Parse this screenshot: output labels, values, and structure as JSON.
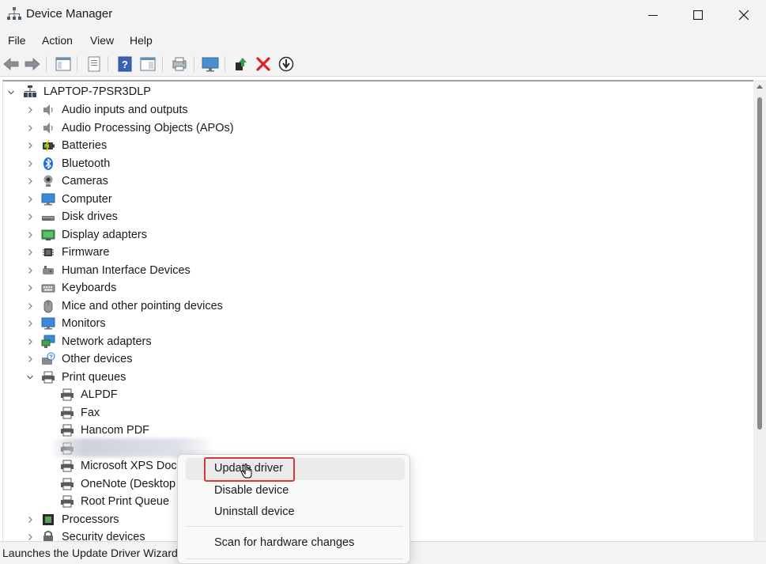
{
  "window": {
    "title": "Device Manager",
    "icon": "device-manager-icon"
  },
  "menu": [
    "File",
    "Action",
    "View",
    "Help"
  ],
  "toolbar": [
    "back-arrow-icon",
    "forward-arrow-icon",
    "show-hide-console-tree-icon",
    "properties-icon",
    "help-icon",
    "action-pane-icon",
    "scan-hardware-icon",
    "monitor-icon",
    "update-driver-icon",
    "uninstall-device-icon",
    "download-icon"
  ],
  "tree": {
    "root": "LAPTOP-7PSR3DLP",
    "categories": [
      {
        "label": "Audio inputs and outputs",
        "icon": "speaker-icon"
      },
      {
        "label": "Audio Processing Objects (APOs)",
        "icon": "speaker-icon"
      },
      {
        "label": "Batteries",
        "icon": "battery-icon"
      },
      {
        "label": "Bluetooth",
        "icon": "bluetooth-icon"
      },
      {
        "label": "Cameras",
        "icon": "camera-icon"
      },
      {
        "label": "Computer",
        "icon": "computer-icon"
      },
      {
        "label": "Disk drives",
        "icon": "disk-drive-icon"
      },
      {
        "label": "Display adapters",
        "icon": "display-adapter-icon"
      },
      {
        "label": "Firmware",
        "icon": "firmware-chip-icon"
      },
      {
        "label": "Human Interface Devices",
        "icon": "hid-icon"
      },
      {
        "label": "Keyboards",
        "icon": "keyboard-icon"
      },
      {
        "label": "Mice and other pointing devices",
        "icon": "mouse-icon"
      },
      {
        "label": "Monitors",
        "icon": "monitor-icon"
      },
      {
        "label": "Network adapters",
        "icon": "network-adapter-icon"
      },
      {
        "label": "Other devices",
        "icon": "unknown-device-icon"
      },
      {
        "label": "Print queues",
        "icon": "printer-icon"
      }
    ],
    "print_queue_children": [
      "ALPDF",
      "Fax",
      "Hancom PDF",
      "",
      "Microsoft XPS Docu",
      "OneNote (Desktop",
      "Root Print Queue"
    ],
    "after": [
      {
        "label": "Processors",
        "icon": "processor-icon"
      },
      {
        "label": "Security devices",
        "icon": "security-device-icon"
      }
    ]
  },
  "context_menu": {
    "items": [
      "Update driver",
      "Disable device",
      "Uninstall device"
    ],
    "scan": "Scan for hardware changes"
  },
  "status": "Launches the Update Driver Wizard"
}
